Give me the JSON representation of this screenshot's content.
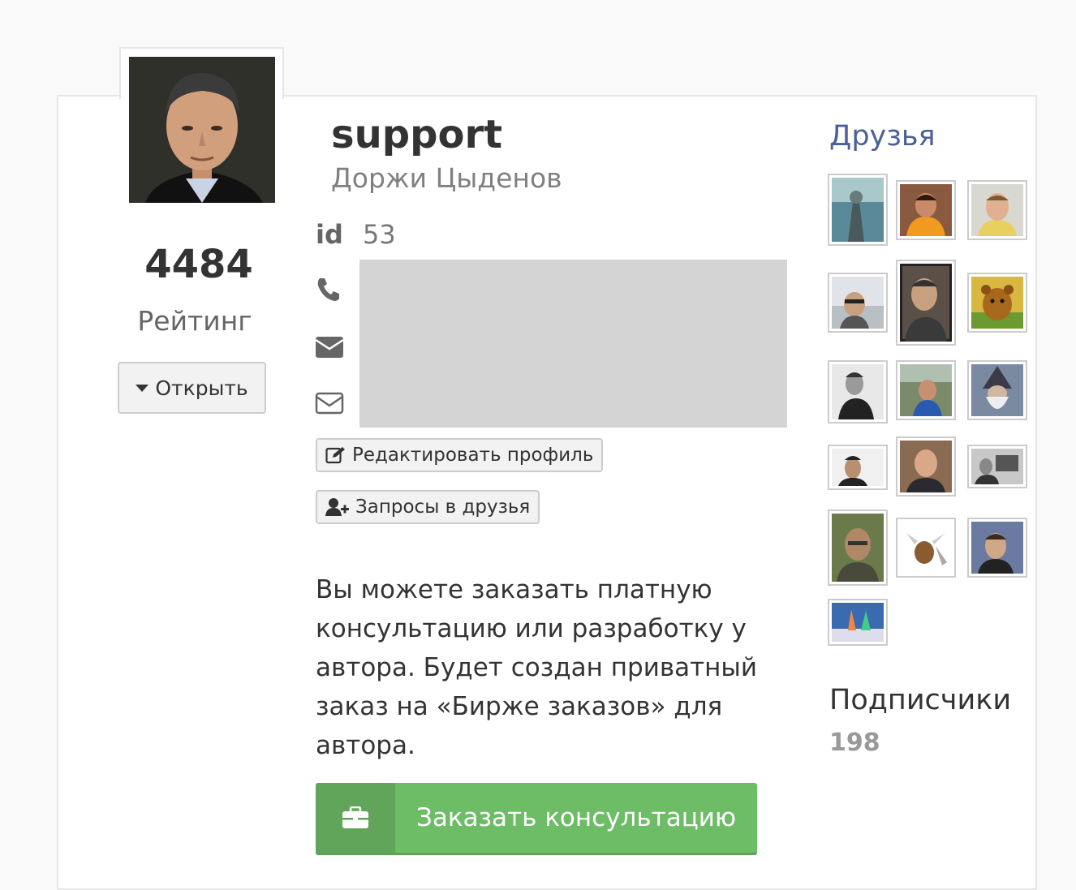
{
  "profile": {
    "username": "support",
    "full_name": "Доржи Цыденов",
    "rating_value": "4484",
    "rating_label": "Рейтинг",
    "open_label": "Открыть",
    "id_label": "id",
    "id_value": "53"
  },
  "actions": {
    "edit_profile_label": "Редактировать профиль",
    "friend_requests_label": "Запросы в друзья"
  },
  "consultation": {
    "text": "Вы можете заказать платную консультацию или разработку у автора. Будет создан приватный заказ на «Бирже заказов» для автора.",
    "button_label": "Заказать консультацию"
  },
  "friends": {
    "title": "Друзья",
    "count_shown": 16
  },
  "subscribers": {
    "title": "Подписчики",
    "count": "198"
  },
  "colors": {
    "order_button": "#6dbc66",
    "friends_link": "#4a6096",
    "contact_box": "#d4d4d4"
  }
}
